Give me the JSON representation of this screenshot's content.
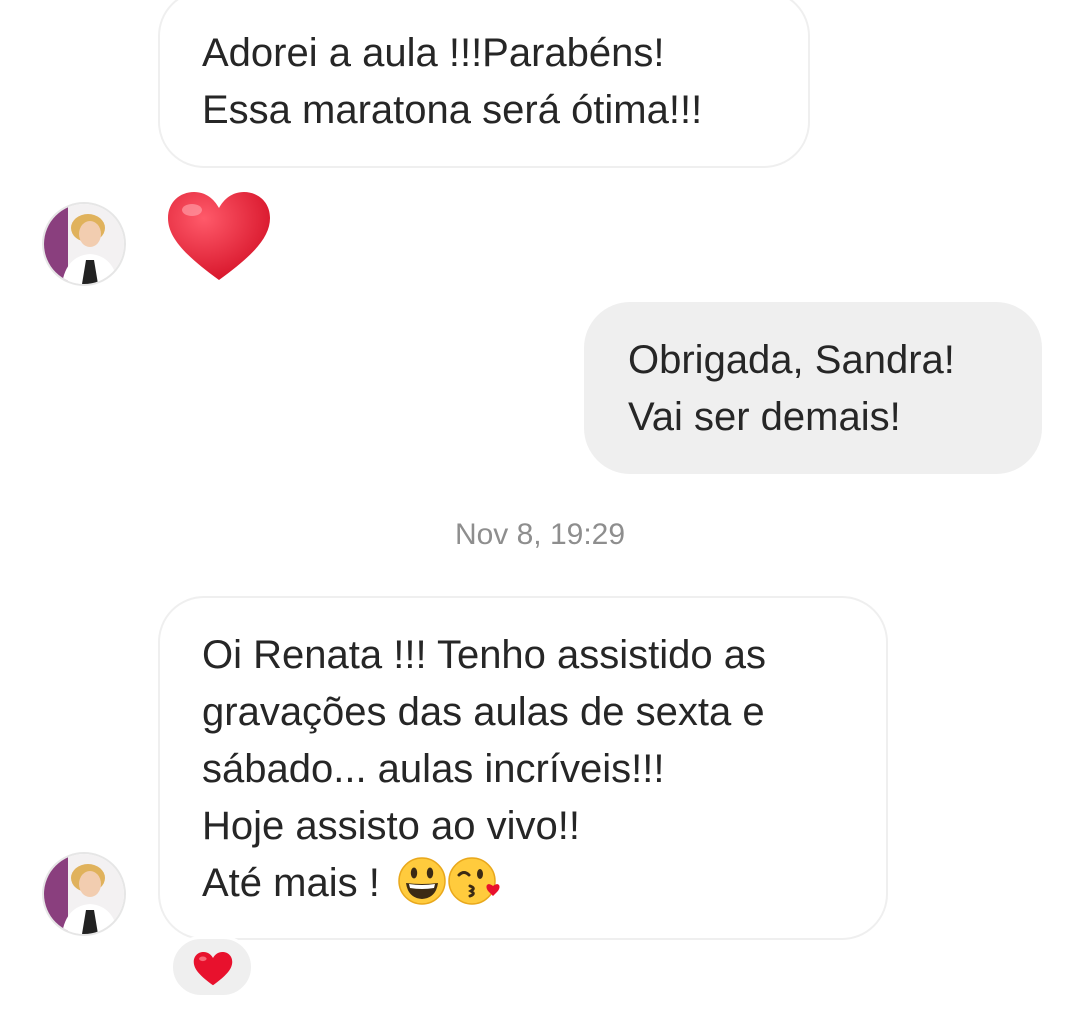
{
  "messages": [
    {
      "sender": "Sandra",
      "direction": "incoming",
      "lines": [
        "Adorei a aula !!!Parabéns!",
        "Essa maratona será ótima!!!"
      ]
    },
    {
      "sender": "Sandra",
      "direction": "incoming",
      "type": "emoji",
      "emoji": "heart-emoji"
    },
    {
      "sender": "me",
      "direction": "outgoing",
      "lines": [
        "Obrigada, Sandra!",
        "Vai ser demais!"
      ]
    },
    {
      "sender": "Sandra",
      "direction": "incoming",
      "lines": [
        "Oi Renata !!! Tenho assistido as",
        "gravações das aulas de sexta e",
        "sábado... aulas incríveis!!!",
        "Hoje assisto ao vivo!!",
        "Até mais ! "
      ],
      "trailing_emojis": [
        "grinning-face-emoji",
        "face-blowing-kiss-emoji"
      ],
      "reaction": "heart-emoji"
    }
  ],
  "timestamp": "Nov 8, 19:29",
  "colors": {
    "outgoing_bubble": "#efefef",
    "incoming_border": "#efefef",
    "text": "#262626",
    "timestamp": "#8e8e8e",
    "heart": "#e8112d",
    "avatar_accent": "#8a3f7e"
  }
}
